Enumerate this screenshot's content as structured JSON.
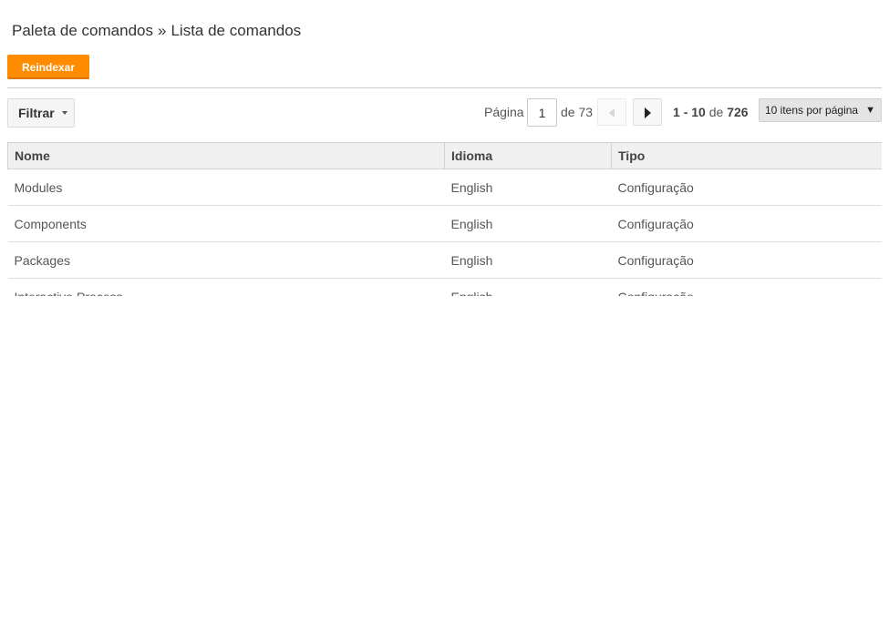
{
  "breadcrumb": {
    "parent": "Paleta de comandos",
    "separator": "»",
    "current": "Lista de comandos"
  },
  "toolbar": {
    "reindex_label": "Reindexar",
    "filter_label": "Filtrar"
  },
  "pagination": {
    "page_label": "Página",
    "current_page": "1",
    "of_label": "de",
    "total_pages": "73",
    "range_start": "1",
    "range_dash": "-",
    "range_end": "10",
    "range_of": "de",
    "total_items": "726",
    "per_page_label": "10 itens por página"
  },
  "table": {
    "columns": [
      "Nome",
      "Idioma",
      "Tipo"
    ],
    "rows": [
      [
        "Modules",
        "English",
        "Configuração"
      ],
      [
        "Components",
        "English",
        "Configuração"
      ],
      [
        "Packages",
        "English",
        "Configuração"
      ],
      [
        "Interactive Process",
        "English",
        "Configuração"
      ]
    ]
  },
  "colors": {
    "accent": "#ff8c00",
    "header_bg": "#f0f0f0"
  }
}
